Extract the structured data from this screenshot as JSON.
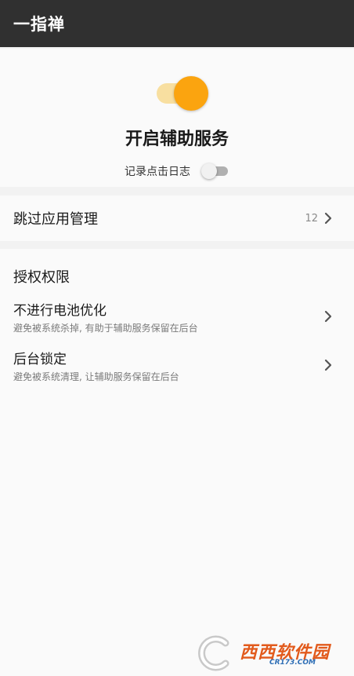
{
  "app_bar": {
    "title": "一指禅"
  },
  "service": {
    "enabled": true,
    "title": "开启辅助服务",
    "log_label": "记录点击日志",
    "log_enabled": false
  },
  "skip_apps": {
    "label": "跳过应用管理",
    "count": "12"
  },
  "permissions": {
    "header": "授权权限",
    "items": [
      {
        "title": "不进行电池优化",
        "desc": "避免被系统杀掉, 有助于辅助服务保留在后台",
        "icon": "chevron-right-icon"
      },
      {
        "title": "后台锁定",
        "desc": "避免被系统清理, 让辅助服务保留在后台",
        "icon": "chevron-right-icon"
      }
    ]
  },
  "watermark": {
    "text": "西西软件园",
    "sub": "CR173.COM"
  },
  "colors": {
    "app_bar": "#303030",
    "accent": "#fba40f",
    "accent_track": "#f8dfa0",
    "background": "#f2f2f2",
    "card": "#fafafa"
  }
}
